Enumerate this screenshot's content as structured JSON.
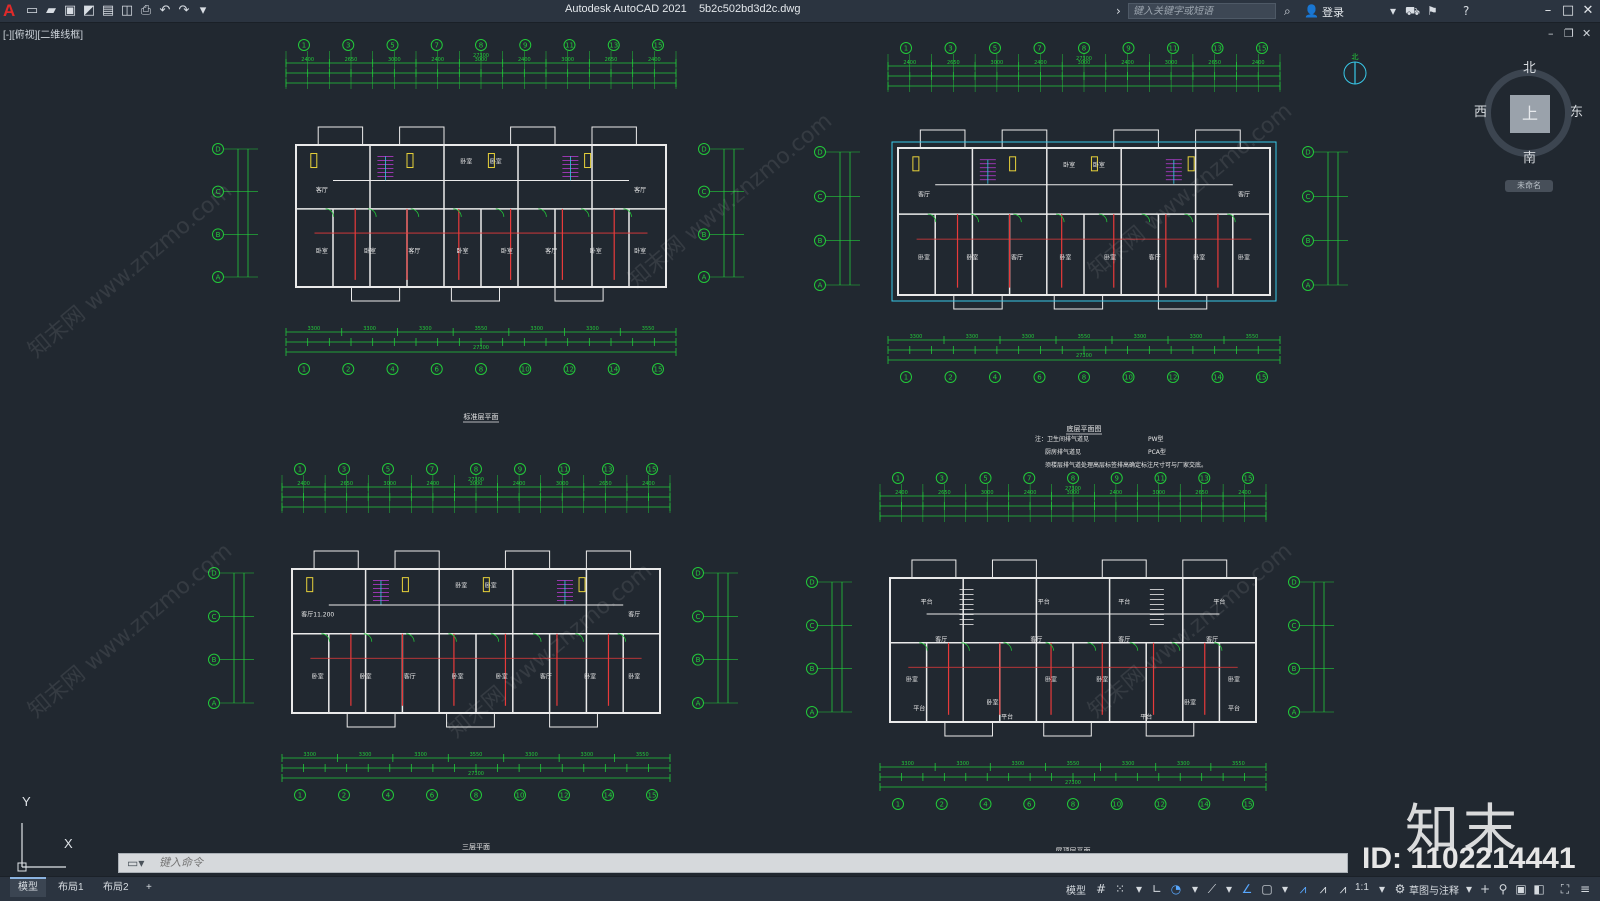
{
  "app": {
    "logo": "A",
    "title": "Autodesk AutoCAD 2021",
    "filename": "5b2c502bd3d2c.dwg",
    "search_placeholder": "键入关键字或短语",
    "login": "登录"
  },
  "quick_access": [
    "new-icon",
    "open-icon",
    "save-icon",
    "save-as-icon",
    "plot-preview-icon",
    "publish-icon",
    "print-icon",
    "undo-icon",
    "redo-icon",
    "customize-icon"
  ],
  "viewport": {
    "label": "[-][俯视][二维线框]",
    "viewcube": {
      "north": "北",
      "south": "南",
      "east": "东",
      "west": "西",
      "face": "上",
      "wcs": "未命名"
    },
    "ucs": {
      "x": "X",
      "y": "Y"
    }
  },
  "drawing": {
    "plans": [
      {
        "title": "标准层平面"
      },
      {
        "title": "底层平面图"
      },
      {
        "title": "三层平面"
      },
      {
        "title": "屋顶层平面"
      }
    ],
    "notes": [
      "注：卫生间排气道见",
      "厨房排气道见",
      "须楼层排气道处理高层标签排高确定标注尺寸可与厂家交底。",
      "PW型",
      "PCA型"
    ],
    "room_labels": {
      "living": "客厅",
      "bedroom": "卧室",
      "living_with_area": "客厅11.200",
      "balcony": "平台",
      "storage": "储藏"
    },
    "total_dim": "27300",
    "dims_top": [
      "2400",
      "2650",
      "3000",
      "2400",
      "3000",
      "2400",
      "3000",
      "2650",
      "2400"
    ],
    "dims_bottom": [
      "3300",
      "3300",
      "3300",
      "3550",
      "3300",
      "3300",
      "3550"
    ],
    "axis_numbers_top": [
      "1",
      "3",
      "5",
      "7",
      "8",
      "9",
      "11",
      "13",
      "15"
    ],
    "axis_numbers_bottom": [
      "1",
      "2",
      "4",
      "6",
      "8",
      "10",
      "12",
      "14",
      "15"
    ],
    "axis_letters": [
      "D",
      "C",
      "B",
      "A"
    ]
  },
  "command": {
    "placeholder": "键入命令"
  },
  "branding": {
    "logo": "知末",
    "id": "ID: 1102214441",
    "watermark": "知末网 www.znzmo.com"
  },
  "status": {
    "tabs": [
      "模型",
      "布局1",
      "布局2"
    ],
    "add_tab": "+",
    "model_label": "模型",
    "scale": "1:1",
    "workspace": "草图与注释"
  },
  "colors": {
    "linework": "#22c93a",
    "walls": "#eaeaea",
    "accent": "#38c8e8",
    "red": "#e83a3a",
    "yellow": "#e8d23a",
    "magenta": "#c03ad8"
  }
}
